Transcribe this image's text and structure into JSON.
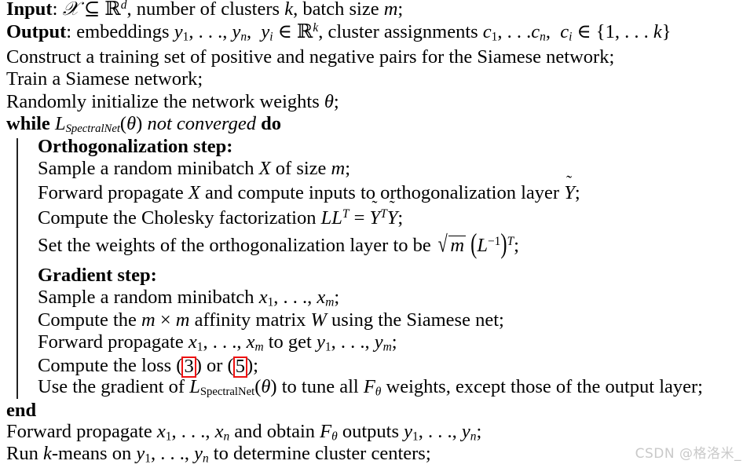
{
  "document": {
    "kind": "algorithm-pseudocode",
    "lines": [
      {
        "id": "input",
        "keyword": "Input",
        "text": "Input: X ⊆ R^d, number of clusters k, batch size m;"
      },
      {
        "id": "output",
        "keyword": "Output",
        "text": "Output: embeddings y_1, …, y_n, y_i ∈ R^k, cluster assignments c_1, … c_n, c_i ∈ {1, … k}"
      },
      {
        "id": "construct",
        "text": "Construct a training set of positive and negative pairs for the Siamese network;"
      },
      {
        "id": "train-siamese",
        "text": "Train a Siamese network;"
      },
      {
        "id": "random-init",
        "text": "Randomly initialize the network weights θ;"
      },
      {
        "id": "while",
        "keyword_start": "while",
        "keyword_end": "do",
        "condition": "L_SpectralNet(θ) not converged",
        "text": "while L_SpectralNet(θ) not converged do"
      },
      {
        "id": "orthogonalization-heading",
        "text": "Orthogonalization step:"
      },
      {
        "id": "sample-minibatch-X",
        "text": "Sample a random minibatch X of size m;"
      },
      {
        "id": "forward-propagate-X",
        "text": "Forward propagate X and compute inputs to orthogonalization layer Ỹ;"
      },
      {
        "id": "cholesky",
        "text": "Compute the Cholesky factorization LL^T = Ỹ^T Ỹ;"
      },
      {
        "id": "set-weights",
        "text": "Set the weights of the orthogonalization layer to be √m (L^−1)^T;"
      },
      {
        "id": "gradient-heading",
        "text": "Gradient step:"
      },
      {
        "id": "sample-minibatch-x",
        "text": "Sample a random minibatch x_1, …, x_m;"
      },
      {
        "id": "affinity-matrix",
        "text": "Compute the m × m affinity matrix W using the Siamese net;"
      },
      {
        "id": "forward-propagate-x",
        "text": "Forward propagate x_1, …, x_m to get y_1, …, y_m;"
      },
      {
        "id": "compute-loss",
        "text": "Compute the loss (3) or (5);",
        "refs": [
          "3",
          "5"
        ],
        "ref_highlight_color": "#ee1111"
      },
      {
        "id": "use-gradient",
        "text": "Use the gradient of L_SpectralNet(θ) to tune all F_θ weights, except those of the output layer;"
      },
      {
        "id": "end",
        "text": "end"
      },
      {
        "id": "forward-propagate-all",
        "text": "Forward propagate x_1, …, x_n and obtain F_θ outputs y_1, …, y_n;"
      },
      {
        "id": "run-kmeans",
        "text": "Run k-means on y_1, …, y_n to determine cluster centers;"
      }
    ],
    "tokens": {
      "input_label": "Input",
      "output_label": "Output",
      "colon": ":",
      "subseteq": "⊆",
      "in": "∈",
      "times": "×",
      "ldots": ". . .",
      "theta": "θ",
      "blackboard_r": "ℝ",
      "script_x": "𝒳",
      "spectralnet_sub": "SpectralNet",
      "while_kw": "while",
      "do_kw": "do",
      "end_kw": "end",
      "orthogonalization_heading": "Orthogonalization step:",
      "gradient_heading": "Gradient step:",
      "ref_3": "3",
      "ref_5": "5"
    }
  },
  "watermark": {
    "text": "CSDN @格洛米_",
    "color": "#c9c9c9"
  }
}
